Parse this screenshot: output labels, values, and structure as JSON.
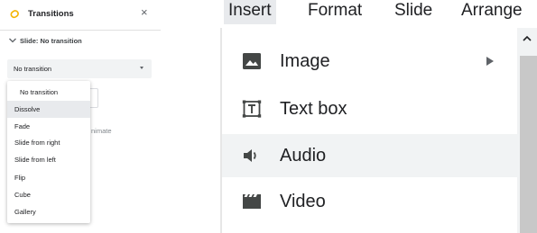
{
  "transitions_panel": {
    "title": "Transitions",
    "close_glyph": "×",
    "section_label": "Slide: No transition",
    "select_value": "No transition",
    "dropdown_options": [
      "No transition",
      "Dissolve",
      "Fade",
      "Slide from right",
      "Slide from left",
      "Flip",
      "Cube",
      "Gallery"
    ],
    "selected_option_index": 1,
    "partially_hidden_text": "nimate",
    "icons": {
      "title_icon": "transition-icon",
      "section_icon": "chevron-down-icon",
      "select_icon": "caret-down-icon"
    },
    "accent_color": "#f4b400"
  },
  "menubar": {
    "items": [
      "Insert",
      "Format",
      "Slide",
      "Arrange"
    ],
    "active_index": 0
  },
  "insert_menu": {
    "items": [
      {
        "label": "Image",
        "icon": "image-icon",
        "has_submenu": true
      },
      {
        "label": "Text box",
        "icon": "text-box-icon",
        "has_submenu": false
      },
      {
        "label": "Audio",
        "icon": "audio-icon",
        "has_submenu": false
      },
      {
        "label": "Video",
        "icon": "video-icon",
        "has_submenu": false
      }
    ],
    "hovered_index": 2
  }
}
